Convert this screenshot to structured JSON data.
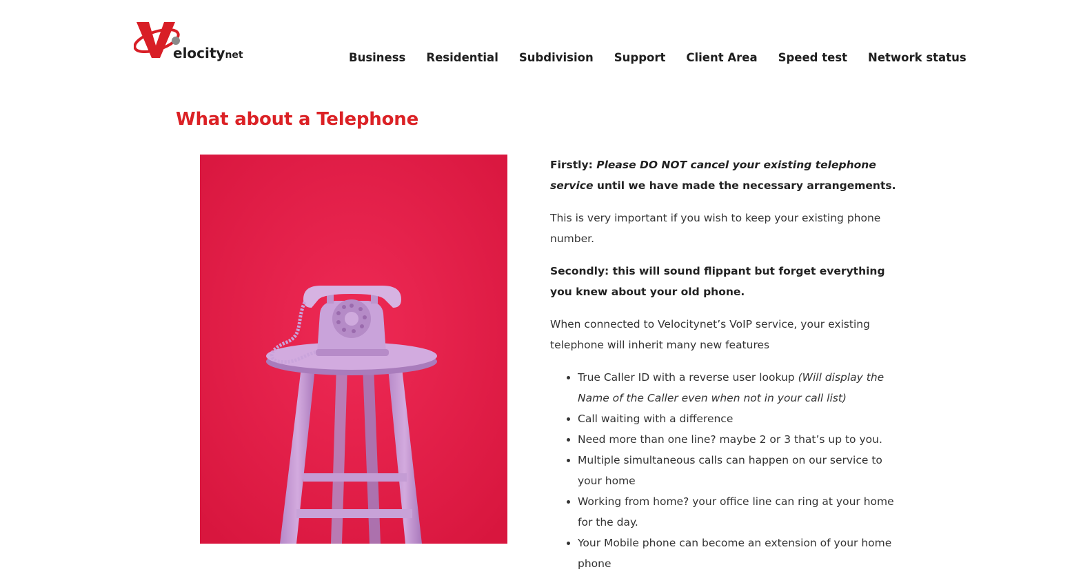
{
  "logo": {
    "alt": "Velocitynet",
    "mark": "V",
    "word": "elocity",
    "suffix": "net"
  },
  "nav": [
    {
      "label": "Business"
    },
    {
      "label": "Residential"
    },
    {
      "label": "Subdivision"
    },
    {
      "label": "Support"
    },
    {
      "label": "Client Area"
    },
    {
      "label": "Speed test"
    },
    {
      "label": "Network status"
    }
  ],
  "page": {
    "title": "What about a Telephone",
    "image_icon": "pink-rotary-telephone-on-stool-photo"
  },
  "content": {
    "p1_lead": "Firstly:",
    "p1_emphasis": "Please DO NOT cancel your existing telephone service",
    "p1_tail": "until we have made the necessary arrangements.",
    "p2": "This is very important if you wish to keep your existing phone number.",
    "p3": "Secondly: this will sound flippant but forget everything you knew about your old phone.",
    "p4": "When connected to Velocitynet’s VoIP service, your existing telephone will inherit many new features",
    "features": [
      {
        "text": "True Caller ID with a reverse user lookup ",
        "note": "(Will display the Name of the Caller even when not in your call list)"
      },
      {
        "text": "Call waiting with a difference",
        "note": ""
      },
      {
        "text": "Need more than one line? maybe 2 or 3 that’s up to you.",
        "note": ""
      },
      {
        "text": "Multiple simultaneous calls can happen on our service to your home",
        "note": ""
      },
      {
        "text": "Working from home? your office line can ring at your home for the day.",
        "note": ""
      },
      {
        "text": "Your Mobile phone can become an extension of your home phone",
        "note": ""
      }
    ]
  },
  "colors": {
    "accent": "#db2125",
    "text": "#333333",
    "nav": "#1e1e1e"
  }
}
